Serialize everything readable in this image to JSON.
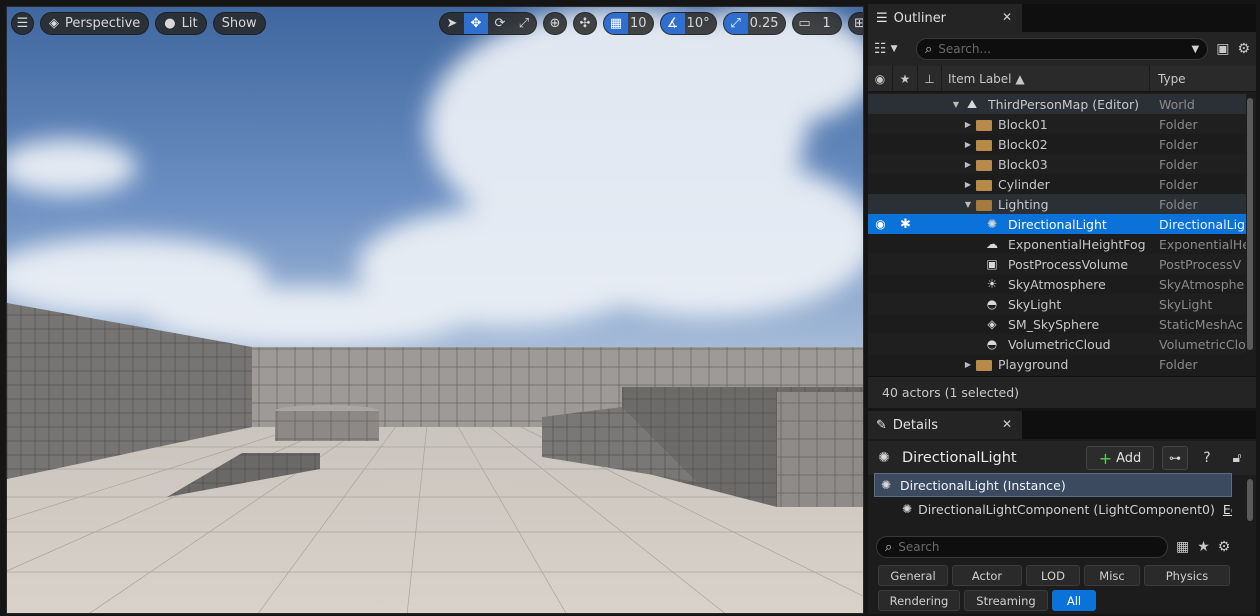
{
  "viewport": {
    "menu_icon": "hamburger-icon",
    "perspective_label": "Perspective",
    "lit_label": "Lit",
    "show_label": "Show",
    "grid_snap_value": "10",
    "rotation_snap_value": "10°",
    "scale_snap_value": "0.25",
    "camera_speed_value": "1"
  },
  "outliner": {
    "tab_label": "Outliner",
    "search_placeholder": "Search...",
    "columns": {
      "item_label": "Item Label ▲",
      "type": "Type"
    },
    "rows": [
      {
        "label": "ThirdPersonMap (Editor)",
        "type": "World",
        "icon": "world-icon"
      },
      {
        "label": "Block01",
        "type": "Folder",
        "icon": "folder-icon"
      },
      {
        "label": "Block02",
        "type": "Folder",
        "icon": "folder-icon"
      },
      {
        "label": "Block03",
        "type": "Folder",
        "icon": "folder-icon"
      },
      {
        "label": "Cylinder",
        "type": "Folder",
        "icon": "folder-icon"
      },
      {
        "label": "Lighting",
        "type": "Folder",
        "icon": "folder-open-icon"
      },
      {
        "label": "DirectionalLight",
        "type": "DirectionalLig",
        "icon": "directional-light-icon"
      },
      {
        "label": "ExponentialHeightFog",
        "type": "ExponentialHe",
        "icon": "fog-icon"
      },
      {
        "label": "PostProcessVolume",
        "type": "PostProcessV",
        "icon": "post-process-icon"
      },
      {
        "label": "SkyAtmosphere",
        "type": "SkyAtmosphe",
        "icon": "sky-atmosphere-icon"
      },
      {
        "label": "SkyLight",
        "type": "SkyLight",
        "icon": "sky-light-icon"
      },
      {
        "label": "SM_SkySphere",
        "type": "StaticMeshAc",
        "icon": "static-mesh-icon"
      },
      {
        "label": "VolumetricCloud",
        "type": "VolumetricClo",
        "icon": "cloud-icon"
      },
      {
        "label": "Playground",
        "type": "Folder",
        "icon": "folder-icon"
      }
    ],
    "status": "40 actors (1 selected)"
  },
  "details": {
    "tab_label": "Details",
    "title": "DirectionalLight",
    "add_label": "Add",
    "instance_label": "DirectionalLight (Instance)",
    "component_label": "DirectionalLightComponent (LightComponent0)",
    "edit_label": "Edit i",
    "search_placeholder": "Search",
    "categories": [
      "General",
      "Actor",
      "LOD",
      "Misc",
      "Physics",
      "Rendering",
      "Streaming",
      "All"
    ],
    "active_category": "All"
  },
  "colors": {
    "accent": "#0a72d8",
    "panel": "#1c1c1c",
    "folder": "#b88a4a"
  }
}
